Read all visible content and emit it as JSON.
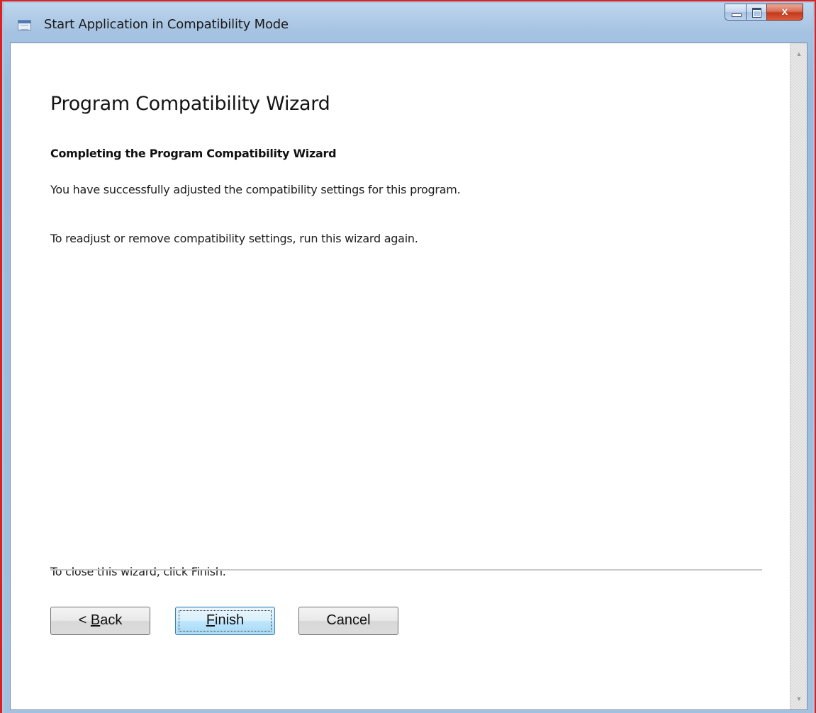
{
  "window": {
    "title": "Start Application in Compatibility Mode",
    "controls": {
      "minimize_icon": "minimize-icon",
      "maximize_icon": "maximize-icon",
      "close_glyph": "x"
    },
    "accent_colors": {
      "frame_border": "#e02020",
      "frame": "#a6c3e2",
      "close_button": "#c4391c"
    }
  },
  "wizard": {
    "heading": "Program Compatibility Wizard",
    "subheading": "Completing the Program Compatibility Wizard",
    "message_1": "You have successfully adjusted the compatibility settings for this program.",
    "message_2": "To readjust or remove compatibility settings, run this wizard again.",
    "close_hint": "To close this wizard, click Finish."
  },
  "buttons": {
    "back": {
      "prefix": "< ",
      "accel": "B",
      "rest": "ack"
    },
    "finish": {
      "accel": "F",
      "rest": "inish"
    },
    "cancel": {
      "label": "Cancel"
    }
  },
  "scrollbar": {
    "up_glyph": "▲",
    "down_glyph": "▼"
  }
}
